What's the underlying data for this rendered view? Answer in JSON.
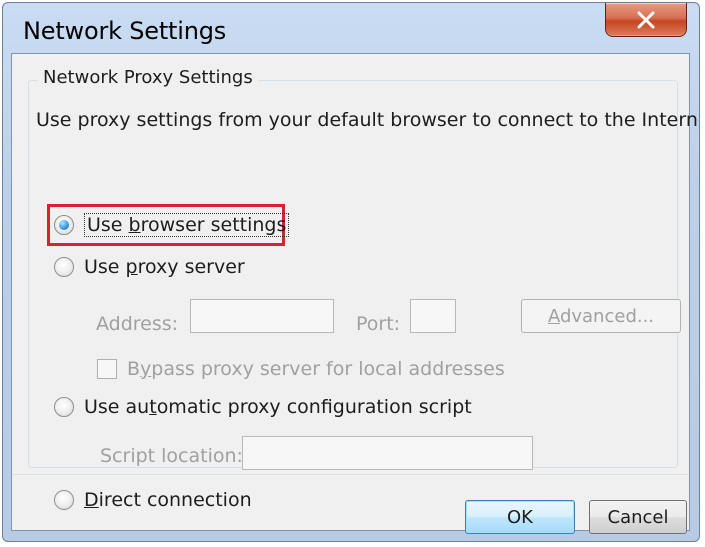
{
  "window": {
    "title": "Network Settings",
    "close_icon": "close-icon"
  },
  "group": {
    "title": "Network Proxy Settings",
    "description": "Use proxy settings from your default browser to connect to the Internet."
  },
  "options": {
    "browser": {
      "prefix": "Use ",
      "accel": "b",
      "suffix": "rowser settings",
      "checked": true
    },
    "proxy_server": {
      "prefix": "Use ",
      "accel": "p",
      "suffix": "roxy server",
      "checked": false
    },
    "automatic": {
      "prefix": "Use au",
      "accel": "t",
      "suffix": "omatic proxy configuration script",
      "checked": false
    },
    "direct": {
      "accel": "D",
      "suffix": "irect connection",
      "checked": false
    }
  },
  "proxy": {
    "address_label": "Address:",
    "address_value": "",
    "port_label": "Port:",
    "port_value": "",
    "advanced": {
      "accel": "A",
      "suffix": "dvanced..."
    },
    "bypass": {
      "prefix": "B",
      "accel": "y",
      "suffix": "pass proxy server for local addresses",
      "checked": false
    }
  },
  "script": {
    "location_label": "Script location:",
    "location_value": ""
  },
  "buttons": {
    "ok": "OK",
    "cancel": "Cancel"
  },
  "colors": {
    "highlight": "#d62332",
    "selected_radio": "#145fa9"
  }
}
